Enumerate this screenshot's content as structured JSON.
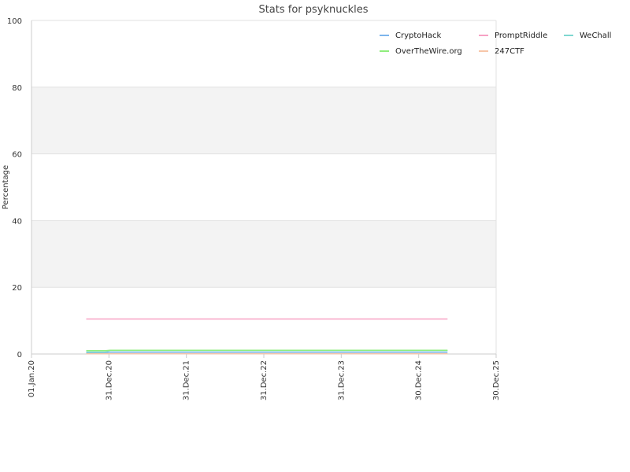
{
  "chart_data": {
    "type": "line",
    "title": "Stats for psyknuckles",
    "xlabel": "",
    "ylabel": "Percentage",
    "ylim": [
      0,
      100
    ],
    "yticks": [
      0,
      20,
      40,
      60,
      80,
      100
    ],
    "xlim": [
      "2020-01-01",
      "2025-12-30"
    ],
    "xticks": [
      {
        "date": "2020-01-01",
        "label": "01.Jan.20"
      },
      {
        "date": "2020-12-31",
        "label": "31.Dec.20"
      },
      {
        "date": "2021-12-31",
        "label": "31.Dec.21"
      },
      {
        "date": "2022-12-31",
        "label": "31.Dec.22"
      },
      {
        "date": "2023-12-31",
        "label": "31.Dec.23"
      },
      {
        "date": "2024-12-30",
        "label": "30.Dec.24"
      },
      {
        "date": "2025-12-30",
        "label": "30.Dec.25"
      }
    ],
    "grid": "horizontal bands",
    "legend_position": "top-right",
    "series": [
      {
        "name": "CryptoHack",
        "color": "#7cb5ec",
        "points": [
          [
            "2020-09-15",
            0.3
          ],
          [
            "2020-12-15",
            0.3
          ],
          [
            "2021-01-05",
            0.5
          ],
          [
            "2025-05-15",
            0.5
          ]
        ]
      },
      {
        "name": "PromptRiddle",
        "color": "#f7a1c4",
        "points": [
          [
            "2020-09-15",
            10.5
          ],
          [
            "2025-05-15",
            10.5
          ]
        ]
      },
      {
        "name": "WeChall",
        "color": "#7fd8d0",
        "points": [
          [
            "2020-09-15",
            0.6
          ],
          [
            "2020-12-15",
            0.6
          ],
          [
            "2021-01-05",
            1.0
          ],
          [
            "2025-05-15",
            1.0
          ]
        ]
      },
      {
        "name": "OverTheWire.org",
        "color": "#90ed7d",
        "points": [
          [
            "2020-09-15",
            1.0
          ],
          [
            "2020-12-15",
            1.0
          ],
          [
            "2021-01-05",
            1.1
          ],
          [
            "2025-05-15",
            1.1
          ]
        ]
      },
      {
        "name": "247CTF",
        "color": "#f7c6a8",
        "points": [
          [
            "2020-09-15",
            0.1
          ],
          [
            "2025-05-15",
            0.1
          ]
        ]
      }
    ]
  }
}
